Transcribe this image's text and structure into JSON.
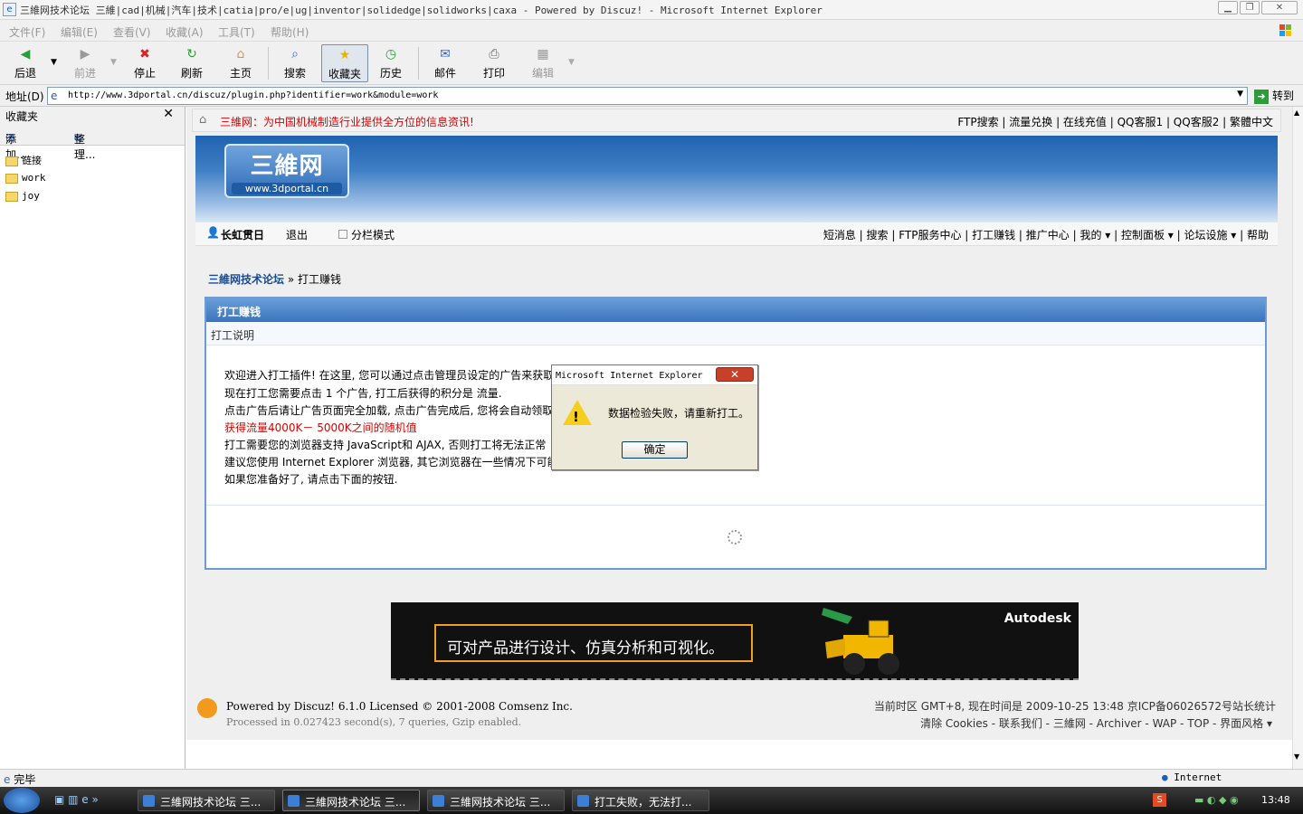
{
  "window": {
    "title": "三維网技术论坛 三維|cad|机械|汽车|技术|catia|pro/e|ug|inventor|solidedge|solidworks|caxa - Powered by Discuz! - Microsoft Internet Explorer"
  },
  "menu": [
    "文件(F)",
    "编辑(E)",
    "查看(V)",
    "收藏(A)",
    "工具(T)",
    "帮助(H)"
  ],
  "toolbar": {
    "back": "后退",
    "forward": "前进",
    "stop": "停止",
    "refresh": "刷新",
    "home": "主页",
    "search": "搜索",
    "favorites": "收藏夹",
    "history": "历史",
    "mail": "邮件",
    "print": "打印",
    "edit": "编辑"
  },
  "address": {
    "label": "地址(D)",
    "url": "http://www.3dportal.cn/discuz/plugin.php?identifier=work&module=work",
    "go": "转到"
  },
  "favorites": {
    "title": "收藏夹",
    "add": "添加...",
    "organize": "整理...",
    "items": [
      "链接",
      "work",
      "joy"
    ]
  },
  "page": {
    "notice": "三維网：为中国机械制造行业提供全方位的信息资讯!",
    "top_links": "FTP搜索 | 流量兑换 | 在线充值 | QQ客服1 | QQ客服2 | 繁體中文",
    "logo_main": "三維网",
    "logo_sub": "www.3dportal.cn",
    "username": "长虹贯日",
    "logout": "退出",
    "split_mode": "分栏模式",
    "nav": "短消息 | 搜索 | FTP服务中心 | 打工赚钱 | 推广中心 | 我的 ▾ | 控制面板 ▾ | 论坛设施 ▾ | 帮助",
    "crumb_home": "三維网技术论坛",
    "crumb_current": "» 打工赚钱",
    "box_title": "打工赚钱",
    "box_sub": "打工说明",
    "lines": [
      "欢迎进入打工插件! 在这里, 您可以通过点击管理员设定的广告来获取",
      "现在打工您需要点击  1 个广告, 打工后获得的积分是  流量.",
      "点击广告后请让广告页面完全加载, 点击广告完成后, 您将会自动领取",
      "获得流量4000K－ 5000K之间的随机值",
      "打工需要您的浏览器支持  JavaScript和  AJAX, 否则打工将无法正常",
      "建议您使用  Internet Explorer 浏览器, 其它浏览器在一些情况下可能无",
      "如果您准备好了, 请点击下面的按钮."
    ],
    "ad_text": "可对产品进行设计、仿真分析和可视化。",
    "ad_brand": "Autodesk",
    "footer_l1": "Powered by Discuz! 6.1.0 Licensed © 2001-2008 Comsenz Inc.",
    "footer_l2": "Processed in 0.027423 second(s), 7 queries, Gzip enabled.",
    "footer_r1": "当前时区  GMT+8, 现在时间是  2009-10-25 13:48 京ICP备06026572号站长统计",
    "footer_r2": "清除  Cookies - 联系我们 - 三維网 - Archiver - WAP - TOP - 界面风格 ▾"
  },
  "dialog": {
    "title": "Microsoft Internet Explorer",
    "message": "数据检验失败，请重新打工。",
    "ok": "确定"
  },
  "statusbar": {
    "left": "完毕",
    "zone": "Internet"
  },
  "taskbar": {
    "tasks": [
      "三維网技术论坛 三...",
      "三維网技术论坛 三...",
      "三維网技术论坛 三...",
      "打工失败，无法打..."
    ],
    "clock": "13:48"
  },
  "colors": {
    "accent": "#3a74bf",
    "notice_red": "#dd0000",
    "warn_yellow": "#f4cf20"
  }
}
